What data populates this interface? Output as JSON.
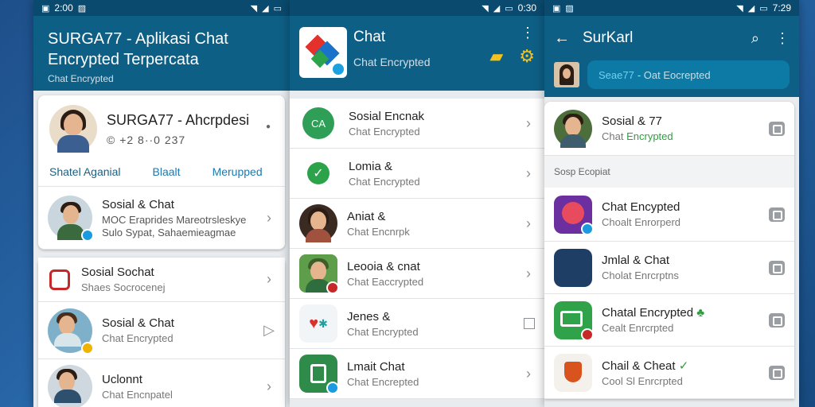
{
  "colors": {
    "appbar": "#0e5f86",
    "statusbar": "#0a4a6e",
    "accent": "#1a7ab0",
    "green": "#2e9e3f"
  },
  "panel1": {
    "status": {
      "time": "2:00"
    },
    "title": "SURGA77 - Aplikasi Chat Encrypted Terpercata",
    "subtitle": "Chat Encrypted",
    "profile": {
      "name": "SURGA77 - Ahcrpdesi",
      "number": "© +2 8··0 237",
      "actions": [
        "Shatel Aganial",
        "Blaalt",
        "Merupped"
      ]
    },
    "rows": [
      {
        "name": "Sosial & Chat",
        "sub1": "MOC Eraprides Mareotrsleskye",
        "sub2": "Sulo Sypat, Sahaemieagmae"
      },
      {
        "name": "Sosial Sochat",
        "sub": "Shaes Socrocenej"
      },
      {
        "name": "Sosial & Chat",
        "sub": "Chat Encrypted"
      },
      {
        "name": "Uclonnt",
        "sub": "Chat Encnpatel"
      }
    ]
  },
  "panel2": {
    "status": {
      "time": "0:30"
    },
    "title": "Chat",
    "subtitle": "Chat Encrypted",
    "rows": [
      {
        "name": "Sosial Encnak",
        "sub": "Chat Encrypted",
        "icon": "CA"
      },
      {
        "name": "Lomia &",
        "sub": "Chat Encrypted"
      },
      {
        "name": "Aniat &",
        "sub": "Chat Encnrpk"
      },
      {
        "name": "Leooia & cnat",
        "sub": "Chat Eaccrypted"
      },
      {
        "name": "Jenes &",
        "sub": "Chat Encrypted"
      },
      {
        "name": "Lmait Chat",
        "sub": "Chat Encrepted"
      }
    ]
  },
  "panel3": {
    "status": {
      "time": "7:29"
    },
    "title": "SurKarl",
    "search": {
      "highlight": "Seae77",
      "text": "- Oat Eocrepted"
    },
    "top_row": {
      "name": "Sosial & 77",
      "sub_plain": "Chat",
      "sub_green": "Encrypted"
    },
    "section": "Sosp Ecopiat",
    "rows": [
      {
        "name": "Chat Encypted",
        "sub": "Choalt Enrorperd"
      },
      {
        "name": "Jmlal & Chat",
        "sub": "Cholat Enrcrptns"
      },
      {
        "name": "Chatal Encrypted",
        "sub": "Cealt Enrcrpted"
      },
      {
        "name": "Chail & Cheat",
        "sub": "Cool Sl Enrcrpted"
      }
    ]
  }
}
